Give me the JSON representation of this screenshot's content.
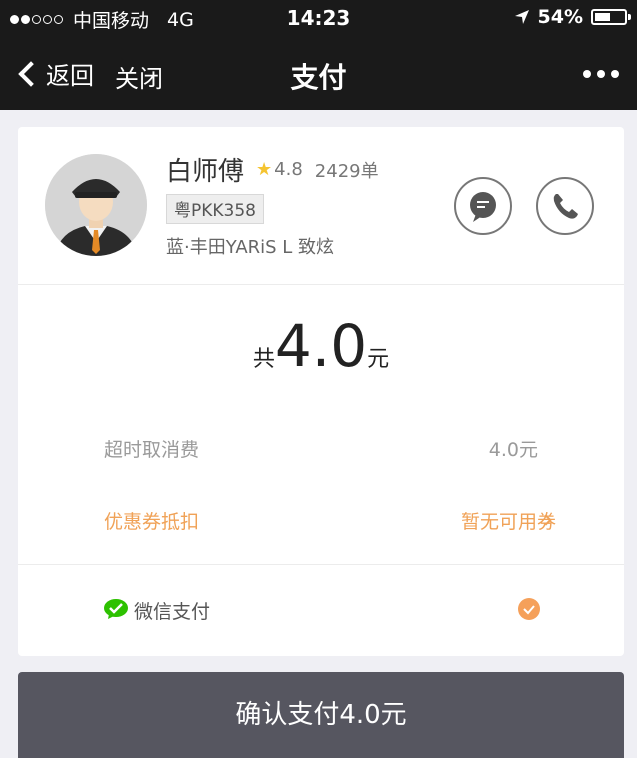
{
  "status_bar": {
    "carrier": "中国移动",
    "network": "4G",
    "time": "14:23",
    "battery": "54%",
    "battery_level": 0.54
  },
  "nav": {
    "back_label": "返回",
    "close_label": "关闭",
    "title": "支付"
  },
  "driver": {
    "name": "白师傅",
    "rating": "4.8",
    "orders": "2429单",
    "plate": "粤PKK358",
    "car": "蓝·丰田YARiS L 致炫"
  },
  "payment": {
    "total_prefix": "共",
    "total_amount": "4.0",
    "total_unit": "元",
    "items": [
      {
        "label": "超时取消费",
        "value": "4.0元"
      }
    ],
    "coupon_label": "优惠券抵扣",
    "coupon_value": "暂无可用券",
    "method_label": "微信支付"
  },
  "confirm_label": "确认支付4.0元",
  "colors": {
    "nav_bg": "#1a1a1a",
    "accent_orange": "#f0a257",
    "wechat_green": "#2dc100",
    "confirm_bg": "#565660"
  }
}
